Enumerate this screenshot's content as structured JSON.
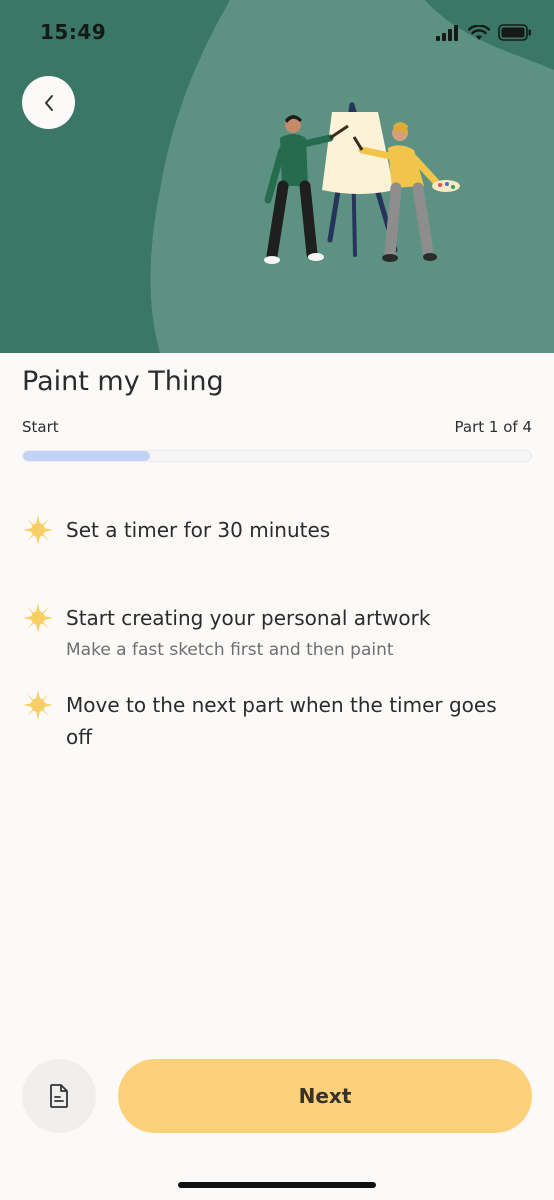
{
  "status_bar": {
    "time": "15:49",
    "icons": [
      "signal-icon",
      "wifi-icon",
      "battery-icon"
    ]
  },
  "header": {
    "back_icon": "chevron-left-icon",
    "illustration": "two-people-painting-illustration"
  },
  "title": "Paint my Thing",
  "progress": {
    "start_label": "Start",
    "part_label": "Part 1 of 4",
    "fraction": 0.25
  },
  "steps": [
    {
      "icon": "sun-bullet-icon",
      "title": "Set a timer for 30 minutes",
      "subtitle": ""
    },
    {
      "icon": "sun-bullet-icon",
      "title": "Start creating your personal artwork",
      "subtitle": "Make a fast sketch first and then paint"
    },
    {
      "icon": "sun-bullet-icon",
      "title": "Move to the next part when the timer goes off",
      "subtitle": ""
    }
  ],
  "footer": {
    "doc_icon": "document-icon",
    "next_label": "Next"
  },
  "colors": {
    "hero_bg": "#3b7766",
    "hero_blob": "#5d9282",
    "accent_yellow": "#fdd17a",
    "progress_fill": "#c3d3f6",
    "bullet": "#f7cf66"
  }
}
